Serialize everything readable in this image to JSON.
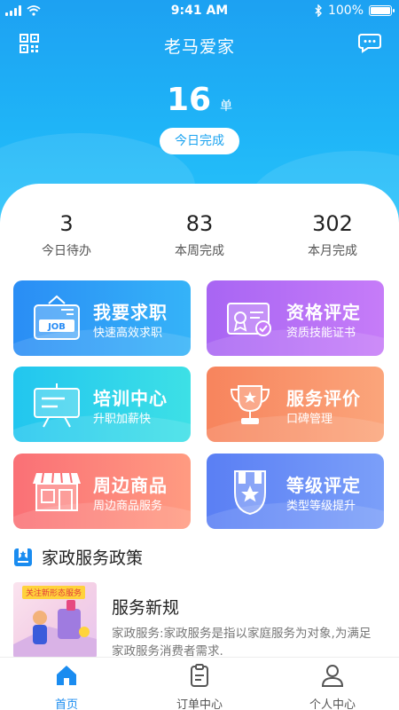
{
  "status_bar": {
    "time": "9:41 AM",
    "battery": "100%"
  },
  "navbar": {
    "title": "老马爱家"
  },
  "hero": {
    "count": "16",
    "unit": "单",
    "button_label": "今日完成"
  },
  "stats": [
    {
      "value": "3",
      "label": "今日待办"
    },
    {
      "value": "83",
      "label": "本周完成"
    },
    {
      "value": "302",
      "label": "本月完成"
    }
  ],
  "cards": [
    {
      "title": "我要求职",
      "subtitle": "快速高效求职",
      "icon": "job-board-icon"
    },
    {
      "title": "资格评定",
      "subtitle": "资质技能证书",
      "icon": "certificate-icon"
    },
    {
      "title": "培训中心",
      "subtitle": "升职加薪快",
      "icon": "presentation-board-icon"
    },
    {
      "title": "服务评价",
      "subtitle": "口碑管理",
      "icon": "trophy-icon"
    },
    {
      "title": "周边商品",
      "subtitle": "周边商品服务",
      "icon": "storefront-icon"
    },
    {
      "title": "等级评定",
      "subtitle": "类型等级提升",
      "icon": "star-badge-icon"
    }
  ],
  "section": {
    "title": "家政服务政策"
  },
  "news": {
    "thumb_tag": "关注新形态服务",
    "title": "服务新规",
    "desc": "家政服务:家政服务是指以家庭服务为对象,为满足家政服务消费者需求."
  },
  "tabs": [
    {
      "label": "首页",
      "active": true
    },
    {
      "label": "订单中心",
      "active": false
    },
    {
      "label": "个人中心",
      "active": false
    }
  ],
  "colors": {
    "primary": "#1da1f2",
    "tab_active": "#1a8cf0"
  }
}
